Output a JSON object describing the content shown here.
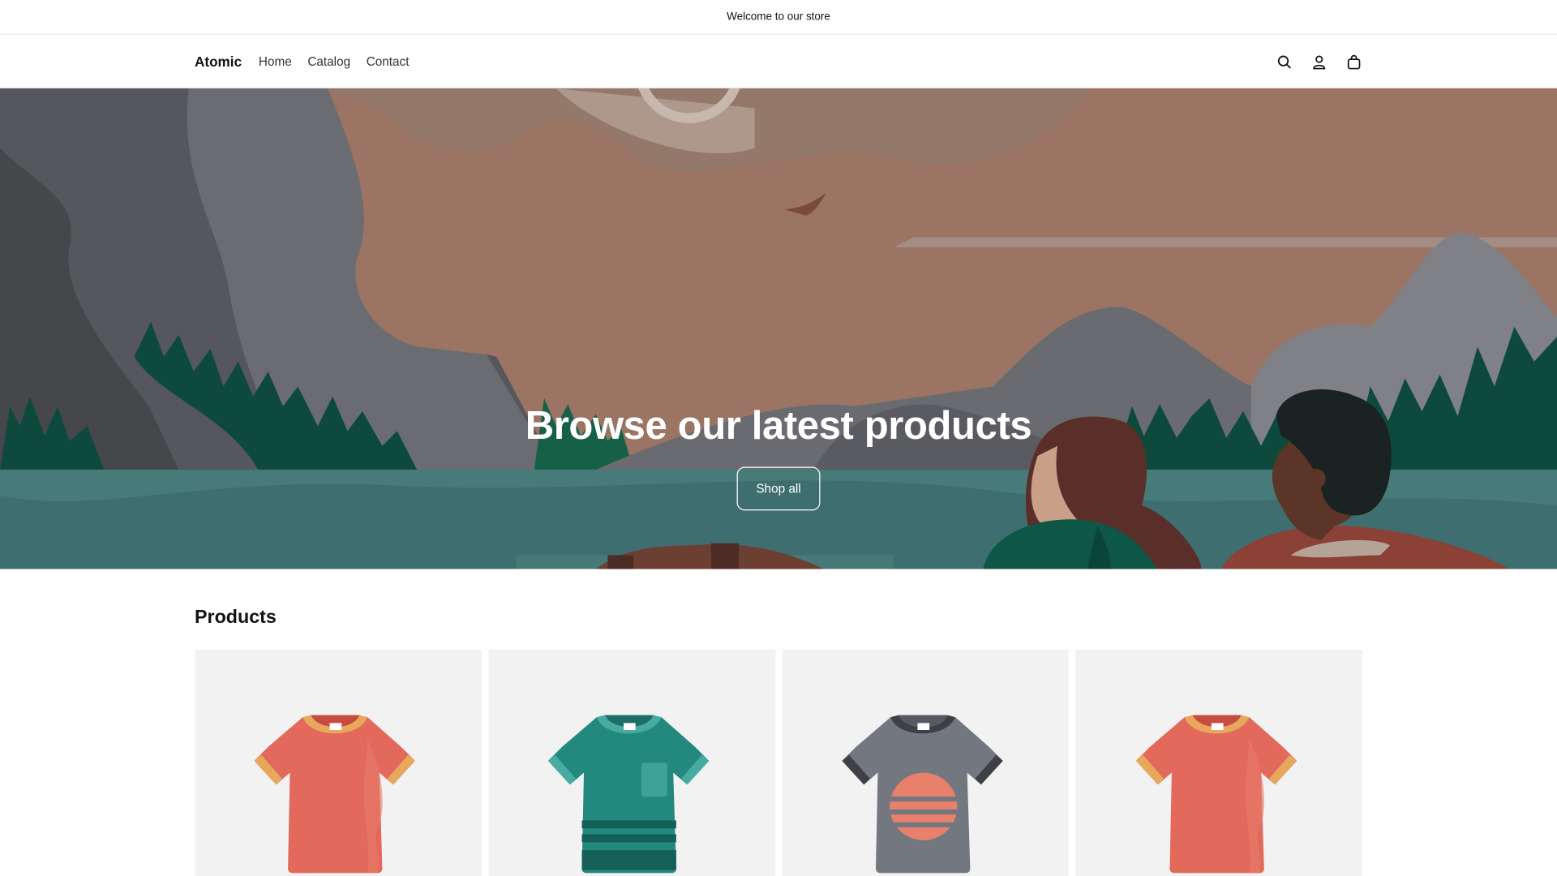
{
  "announcement": {
    "text": "Welcome to our store"
  },
  "header": {
    "logo": "Atomic",
    "nav": [
      "Home",
      "Catalog",
      "Contact"
    ],
    "icons": [
      "search-icon",
      "account-icon",
      "cart-icon"
    ]
  },
  "hero": {
    "title": "Browse our latest products",
    "button_label": "Shop all"
  },
  "products": {
    "heading": "Products",
    "items": [
      {
        "image": "coral t-shirt",
        "color": "#e2695b"
      },
      {
        "image": "teal pocket t-shirt",
        "color": "#23897f"
      },
      {
        "image": "grey sunset t-shirt",
        "color": "#737780"
      },
      {
        "image": "coral t-shirt",
        "color": "#e2695b"
      }
    ]
  }
}
